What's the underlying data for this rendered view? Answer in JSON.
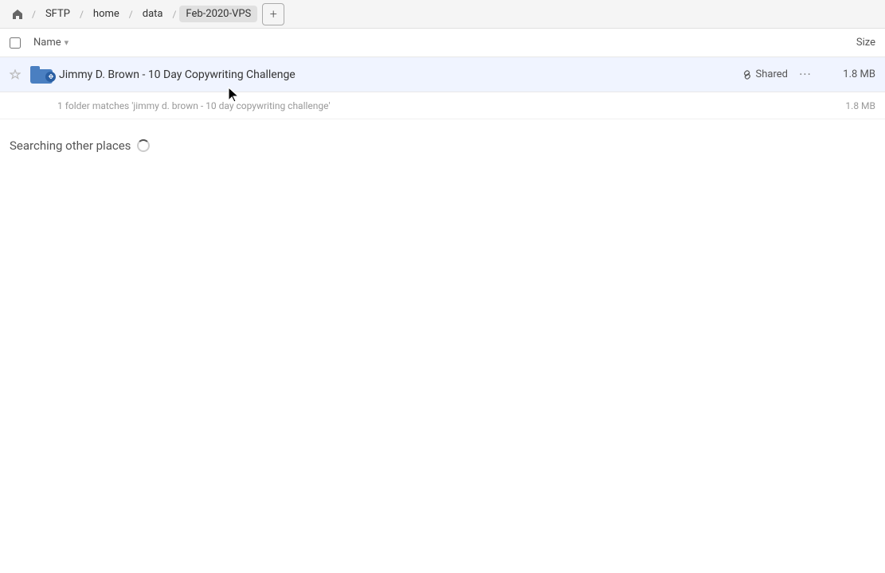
{
  "breadcrumb": {
    "home_icon": "🏠",
    "items": [
      {
        "label": "SFTP",
        "active": false
      },
      {
        "label": "home",
        "active": false
      },
      {
        "label": "data",
        "active": false
      },
      {
        "label": "Feb-2020-VPS",
        "active": true
      }
    ],
    "add_icon": "+"
  },
  "columns": {
    "name_label": "Name",
    "sort_icon": "▾",
    "size_label": "Size"
  },
  "file_row": {
    "name": "Jimmy D. Brown - 10 Day Copywriting Challenge",
    "shared_label": "Shared",
    "more_icon": "···",
    "size": "1.8 MB"
  },
  "match_info": {
    "text": "1 folder matches 'jimmy d. brown - 10 day copywriting challenge'",
    "size": "1.8 MB"
  },
  "searching": {
    "label": "Searching other places"
  }
}
